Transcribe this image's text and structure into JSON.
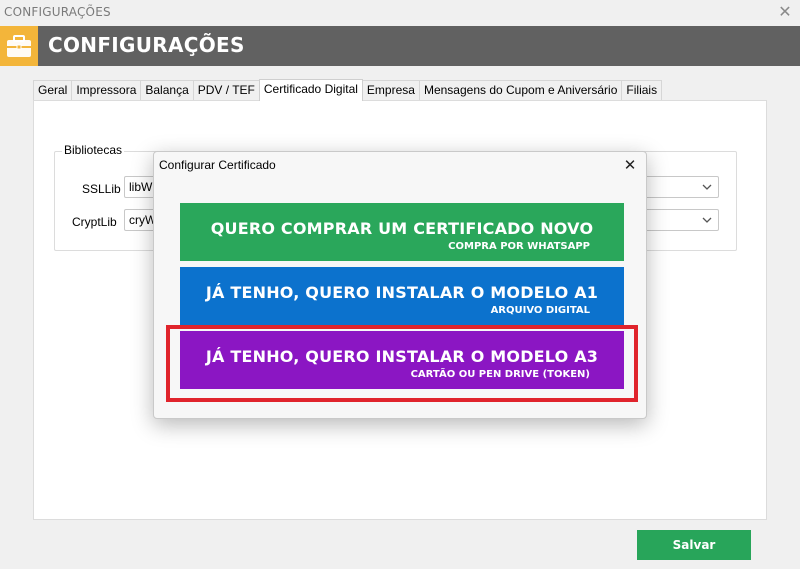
{
  "window": {
    "title": "CONFIGURAÇÕES",
    "close_glyph": "✕"
  },
  "header": {
    "title": "CONFIGURAÇÕES",
    "icon": "briefcase-icon",
    "icon_bg": "#f3b53a",
    "bg": "#616161"
  },
  "tabs": [
    {
      "label": "Geral",
      "active": false
    },
    {
      "label": "Impressora",
      "active": false
    },
    {
      "label": "Balança",
      "active": false
    },
    {
      "label": "PDV / TEF",
      "active": false
    },
    {
      "label": "Certificado Digital",
      "active": true
    },
    {
      "label": "Empresa",
      "active": false
    },
    {
      "label": "Mensagens do Cupom e Aniversário",
      "active": false
    },
    {
      "label": "Filiais",
      "active": false
    }
  ],
  "libraries": {
    "legend": "Bibliotecas",
    "ssllib": {
      "label": "SSLLib",
      "value": "libW"
    },
    "cryptlib": {
      "label": "CryptLib",
      "value": "cryW"
    }
  },
  "save_button": {
    "label": "Salvar",
    "color": "#28a55a"
  },
  "modal": {
    "title": "Configurar Certificado",
    "close_glyph": "✕",
    "options": [
      {
        "main": "QUERO COMPRAR UM CERTIFICADO NOVO",
        "sub": "COMPRA POR WHATSAPP",
        "color": "#2aa75b"
      },
      {
        "main": "JÁ TENHO, QUERO INSTALAR O MODELO A1",
        "sub": "ARQUIVO DIGITAL",
        "color": "#0c72cd"
      },
      {
        "main": "JÁ TENHO, QUERO INSTALAR O MODELO A3",
        "sub": "CARTÃO OU PEN DRIVE (TOKEN)",
        "color": "#8b16c3",
        "highlighted": true
      }
    ],
    "highlight_color": "#e0242c"
  }
}
